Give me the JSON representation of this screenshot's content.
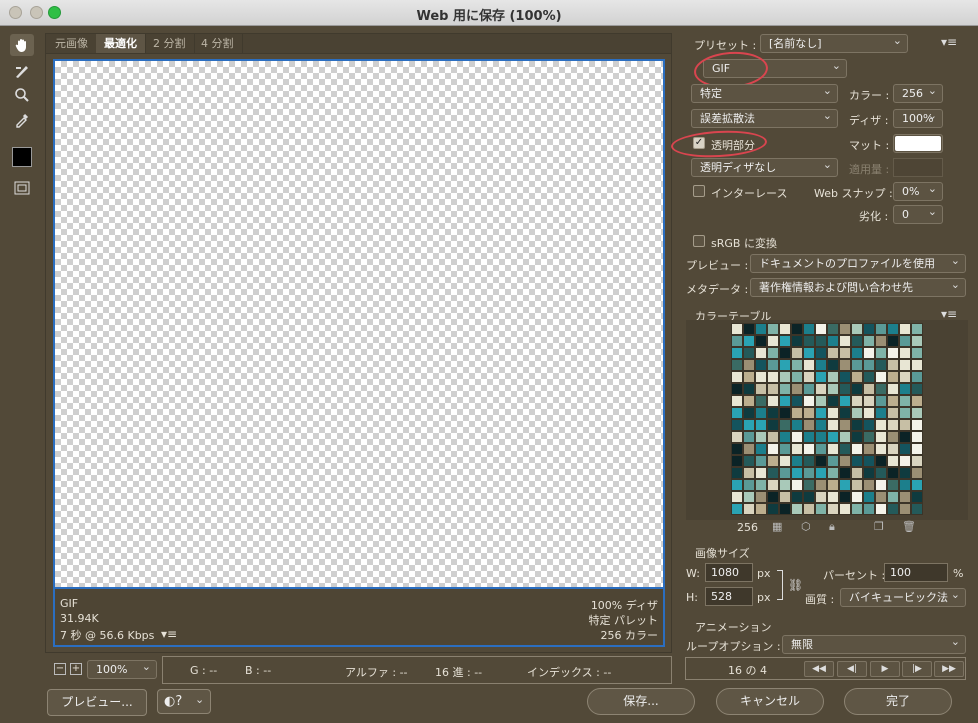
{
  "window": {
    "title": "Web 用に保存 (100%)"
  },
  "tabs": [
    "元画像",
    "最適化",
    "2 分割",
    "4 分割"
  ],
  "active_tab": 1,
  "info": {
    "format": "GIF",
    "size": "31.94K",
    "time": "7 秒 @ 56.6 Kbps",
    "dither": "100% ディザ",
    "palette": "特定 パレット",
    "colors": "256 カラー"
  },
  "zoom": {
    "value": "100%",
    "minus": "−",
    "plus": "+"
  },
  "status": {
    "g": "G : --",
    "b": "B : --",
    "alpha": "アルファ : --",
    "hex": "16 進 : --",
    "index": "インデックス : --"
  },
  "settings": {
    "preset_label": "プリセット :",
    "preset_value": "[名前なし]",
    "format_value": "GIF",
    "reduction_value": "特定",
    "colors_label": "カラー :",
    "colors_value": "256",
    "dither_algo_value": "誤差拡散法",
    "dither_label": "ディザ :",
    "dither_value": "100%",
    "transparency_label": "透明部分",
    "matte_label": "マット :",
    "trans_dither_value": "透明ディザなし",
    "amount_label": "適用量 :",
    "interlace_label": "インターレース",
    "websnap_label": "Web スナップ :",
    "websnap_value": "0%",
    "lossy_label": "劣化 :",
    "lossy_value": "0",
    "srgb_label": "sRGB に変換",
    "preview_label": "プレビュー :",
    "preview_value": "ドキュメントのプロファイルを使用",
    "metadata_label": "メタデータ :",
    "metadata_value": "著作権情報および問い合わせ先"
  },
  "color_table": {
    "title": "カラーテーブル",
    "count": "256"
  },
  "image_size": {
    "title": "画像サイズ",
    "w_label": "W:",
    "w_value": "1080",
    "h_label": "H:",
    "h_value": "528",
    "unit": "px",
    "percent_label": "パーセント :",
    "percent_value": "100",
    "percent_unit": "%",
    "quality_label": "画質 :",
    "quality_value": "バイキュービック法"
  },
  "animation": {
    "title": "アニメーション",
    "loop_label": "ループオプション :",
    "loop_value": "無限",
    "frame": "16 の 4"
  },
  "buttons": {
    "preview": "プレビュー...",
    "save": "保存...",
    "cancel": "キャンセル",
    "done": "完了"
  },
  "colors": {
    "selection": "#2b6ec0",
    "annotation": "#d9454f",
    "panel": "#524938"
  }
}
